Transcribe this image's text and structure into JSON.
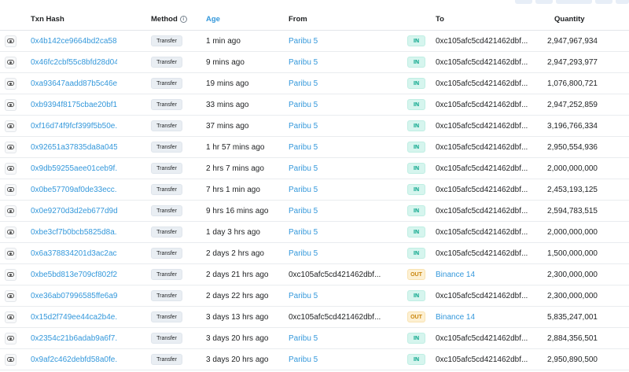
{
  "columns": {
    "hash": "Txn Hash",
    "method": "Method",
    "age": "Age",
    "from": "From",
    "to": "To",
    "quantity": "Quantity"
  },
  "rows": [
    {
      "hash": "0x4b142ce9664bd2ca58...",
      "method": "Transfer",
      "age": "1 min ago",
      "from": "Paribu 5",
      "dir": "IN",
      "to": "0xc105afc5cd421462dbf...",
      "qty": "2,947,967,934"
    },
    {
      "hash": "0x46fc2cbf55c8bfd28d04...",
      "method": "Transfer",
      "age": "9 mins ago",
      "from": "Paribu 5",
      "dir": "IN",
      "to": "0xc105afc5cd421462dbf...",
      "qty": "2,947,293,977"
    },
    {
      "hash": "0xa93647aadd87b5c46e...",
      "method": "Transfer",
      "age": "19 mins ago",
      "from": "Paribu 5",
      "dir": "IN",
      "to": "0xc105afc5cd421462dbf...",
      "qty": "1,076,800,721"
    },
    {
      "hash": "0xb9394f8175cbae20bf1...",
      "method": "Transfer",
      "age": "33 mins ago",
      "from": "Paribu 5",
      "dir": "IN",
      "to": "0xc105afc5cd421462dbf...",
      "qty": "2,947,252,859"
    },
    {
      "hash": "0xf16d74f9fcf399f5b50e...",
      "method": "Transfer",
      "age": "37 mins ago",
      "from": "Paribu 5",
      "dir": "IN",
      "to": "0xc105afc5cd421462dbf...",
      "qty": "3,196,766,334"
    },
    {
      "hash": "0x92651a37835da8a045...",
      "method": "Transfer",
      "age": "1 hr 57 mins ago",
      "from": "Paribu 5",
      "dir": "IN",
      "to": "0xc105afc5cd421462dbf...",
      "qty": "2,950,554,936"
    },
    {
      "hash": "0x9db59255aee01ceb9f...",
      "method": "Transfer",
      "age": "2 hrs 7 mins ago",
      "from": "Paribu 5",
      "dir": "IN",
      "to": "0xc105afc5cd421462dbf...",
      "qty": "2,000,000,000"
    },
    {
      "hash": "0x0be57709af0de33ecc...",
      "method": "Transfer",
      "age": "7 hrs 1 min ago",
      "from": "Paribu 5",
      "dir": "IN",
      "to": "0xc105afc5cd421462dbf...",
      "qty": "2,453,193,125"
    },
    {
      "hash": "0x0e9270d3d2eb677d9d...",
      "method": "Transfer",
      "age": "9 hrs 16 mins ago",
      "from": "Paribu 5",
      "dir": "IN",
      "to": "0xc105afc5cd421462dbf...",
      "qty": "2,594,783,515"
    },
    {
      "hash": "0xbe3cf7b0bcb5825d8a...",
      "method": "Transfer",
      "age": "1 day 3 hrs ago",
      "from": "Paribu 5",
      "dir": "IN",
      "to": "0xc105afc5cd421462dbf...",
      "qty": "2,000,000,000"
    },
    {
      "hash": "0x6a378834201d3ac2ac...",
      "method": "Transfer",
      "age": "2 days 2 hrs ago",
      "from": "Paribu 5",
      "dir": "IN",
      "to": "0xc105afc5cd421462dbf...",
      "qty": "1,500,000,000"
    },
    {
      "hash": "0xbe5bd813e709cf802f2...",
      "method": "Transfer",
      "age": "2 days 21 hrs ago",
      "from": "0xc105afc5cd421462dbf...",
      "dir": "OUT",
      "to": "Binance 14",
      "qty": "2,300,000,000"
    },
    {
      "hash": "0xe36ab07996585ffe6a9...",
      "method": "Transfer",
      "age": "2 days 22 hrs ago",
      "from": "Paribu 5",
      "dir": "IN",
      "to": "0xc105afc5cd421462dbf...",
      "qty": "2,300,000,000"
    },
    {
      "hash": "0x15d2f749ee44ca2b4e...",
      "method": "Transfer",
      "age": "3 days 13 hrs ago",
      "from": "0xc105afc5cd421462dbf...",
      "dir": "OUT",
      "to": "Binance 14",
      "qty": "5,835,247,001"
    },
    {
      "hash": "0x2354c21b6adab9a6f7...",
      "method": "Transfer",
      "age": "3 days 20 hrs ago",
      "from": "Paribu 5",
      "dir": "IN",
      "to": "0xc105afc5cd421462dbf...",
      "qty": "2,884,356,501"
    },
    {
      "hash": "0x9af2c462debfd58a0fe...",
      "method": "Transfer",
      "age": "3 days 20 hrs ago",
      "from": "Paribu 5",
      "dir": "IN",
      "to": "0xc105afc5cd421462dbf...",
      "qty": "2,950,890,500"
    }
  ],
  "colors": {
    "link": "#3498db",
    "in_bg": "#d6f5ee",
    "in_text": "#00a186",
    "out_bg": "#fdf0d3",
    "out_text": "#c9850d"
  },
  "icons": {
    "view": "eye-icon",
    "method_info": "info-circle-icon"
  }
}
